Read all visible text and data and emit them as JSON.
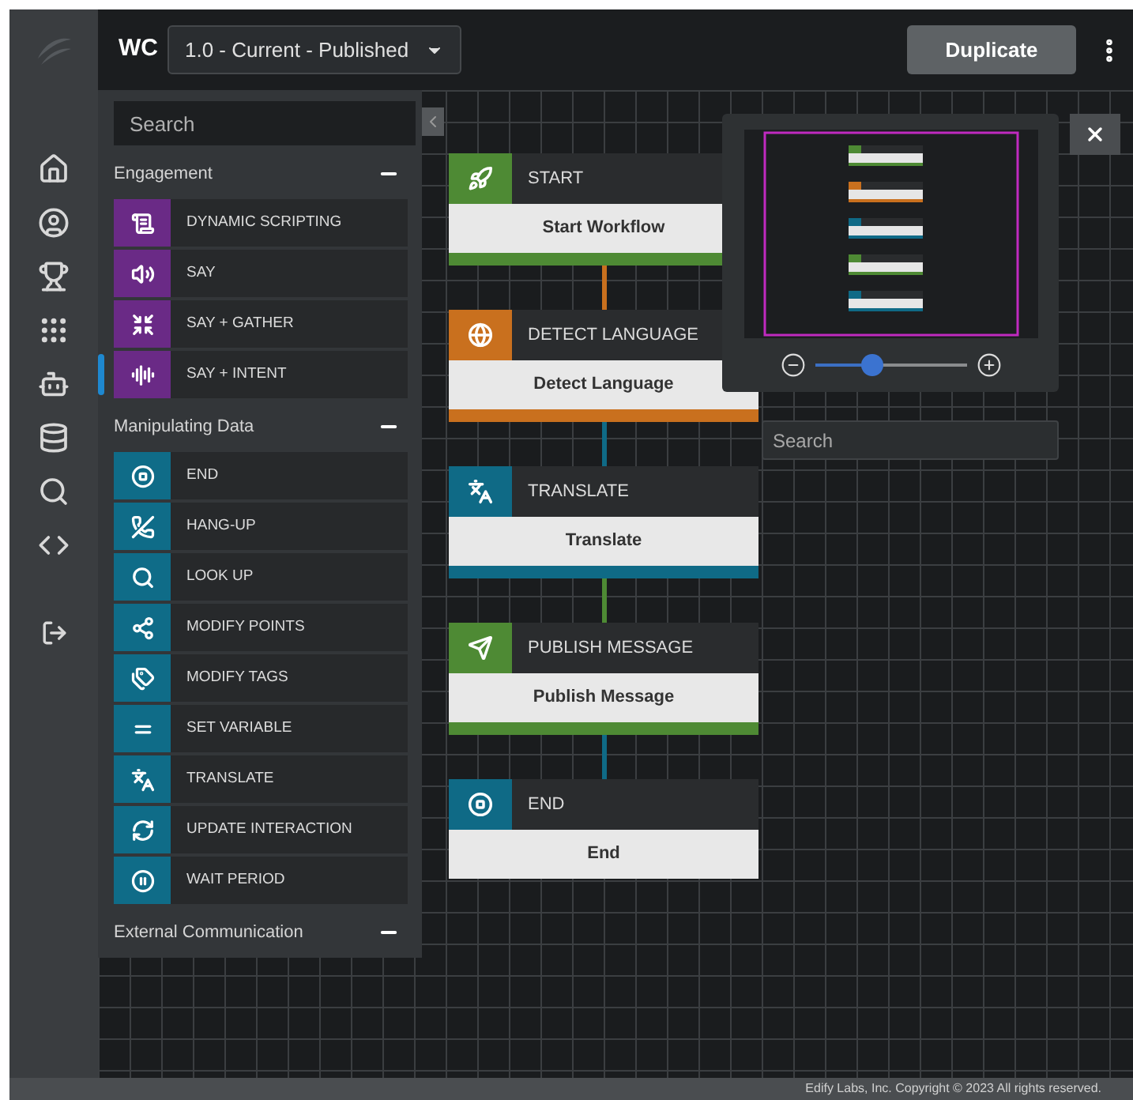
{
  "header": {
    "title": "WC",
    "version_dropdown": "1.0 - Current - Published",
    "duplicate_button": "Duplicate"
  },
  "palette": {
    "search": {
      "placeholder": "Search"
    },
    "sections": [
      {
        "title": "Engagement",
        "expanded": true,
        "items": [
          {
            "label": "DYNAMIC SCRIPTING",
            "selected": false,
            "color": "#6a2a86"
          },
          {
            "label": "SAY",
            "selected": false,
            "color": "#6a2a86"
          },
          {
            "label": "SAY + GATHER",
            "selected": false,
            "color": "#6a2a86"
          },
          {
            "label": "SAY + INTENT",
            "selected": true,
            "color": "#6a2a86"
          }
        ]
      },
      {
        "title": "Manipulating Data",
        "expanded": true,
        "items": [
          {
            "label": "END",
            "selected": false,
            "color": "#0f6c88"
          },
          {
            "label": "HANG-UP",
            "selected": false,
            "color": "#0f6c88"
          },
          {
            "label": "LOOK UP",
            "selected": false,
            "color": "#0f6c88"
          },
          {
            "label": "MODIFY POINTS",
            "selected": false,
            "color": "#0f6c88"
          },
          {
            "label": "MODIFY TAGS",
            "selected": false,
            "color": "#0f6c88"
          },
          {
            "label": "SET VARIABLE",
            "selected": false,
            "color": "#0f6c88"
          },
          {
            "label": "TRANSLATE",
            "selected": false,
            "color": "#0f6c88"
          },
          {
            "label": "UPDATE INTERACTION",
            "selected": false,
            "color": "#0f6c88"
          },
          {
            "label": "WAIT PERIOD",
            "selected": false,
            "color": "#0f6c88"
          }
        ]
      },
      {
        "title": "External Communication",
        "expanded": true
      }
    ]
  },
  "workflow": {
    "nodes": [
      {
        "type": "START",
        "label": "Start Workflow",
        "color": "#4e8a34",
        "footer_bar": true
      },
      {
        "type": "DETECT LANGUAGE",
        "label": "Detect Language",
        "color": "#c9701e",
        "footer_bar": true
      },
      {
        "type": "TRANSLATE",
        "label": "Translate",
        "color": "#0f6a86",
        "footer_bar": true
      },
      {
        "type": "PUBLISH MESSAGE",
        "label": "Publish Message",
        "color": "#4e8a34",
        "footer_bar": true
      },
      {
        "type": "END",
        "label": "End",
        "color": "#0f6a86",
        "footer_bar": false
      }
    ]
  },
  "minimap": {
    "zoom": {
      "level": 0.37
    },
    "search": {
      "placeholder": "Search"
    }
  },
  "footer": "Edify Labs, Inc. Copyright © 2023 All rights reserved."
}
